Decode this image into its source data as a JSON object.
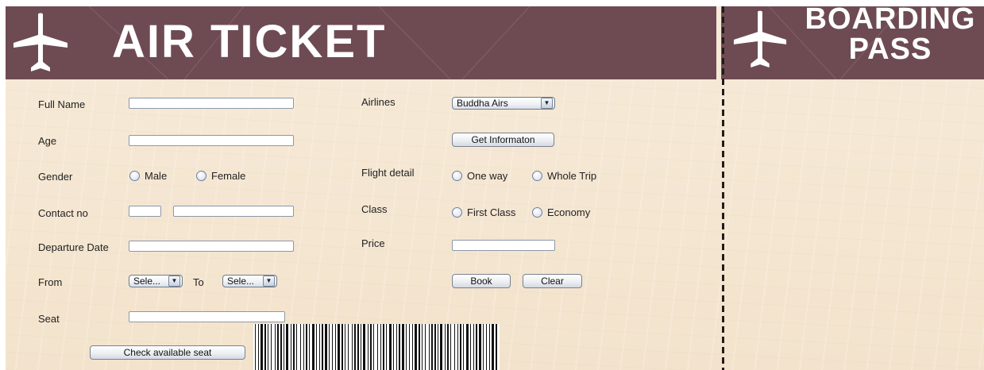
{
  "ticket": {
    "title": "AIR TICKET",
    "header_color": "#6e4b53",
    "background_color": "#f3e3cc",
    "plane_icon": "airplane-icon"
  },
  "boarding_pass": {
    "title_line1": "BOARDING",
    "title_line2": "PASS",
    "plane_icon": "airplane-icon"
  },
  "form": {
    "full_name": {
      "label": "Full Name",
      "value": ""
    },
    "age": {
      "label": "Age",
      "value": ""
    },
    "gender": {
      "label": "Gender",
      "options": [
        "Male",
        "Female"
      ]
    },
    "contact": {
      "label": "Contact no",
      "code_value": "",
      "number_value": ""
    },
    "departure_date": {
      "label": "Departure Date",
      "value": ""
    },
    "from": {
      "label": "From",
      "selected": "Sele...",
      "arrow": "▼"
    },
    "to": {
      "label": "To",
      "selected": "Sele...",
      "arrow": "▼"
    },
    "seat": {
      "label": "Seat",
      "value": ""
    },
    "check_seat_button": "Check available seat",
    "airlines": {
      "label": "Airlines",
      "selected": "Buddha Airs",
      "arrow": "▼"
    },
    "get_information_button": "Get Informaton",
    "flight_detail": {
      "label": "Flight detail",
      "options": [
        "One way",
        "Whole Trip"
      ]
    },
    "class": {
      "label": "Class",
      "options": [
        "First Class",
        "Economy"
      ]
    },
    "price": {
      "label": "Price",
      "value": ""
    },
    "book_button": "Book",
    "clear_button": "Clear"
  }
}
